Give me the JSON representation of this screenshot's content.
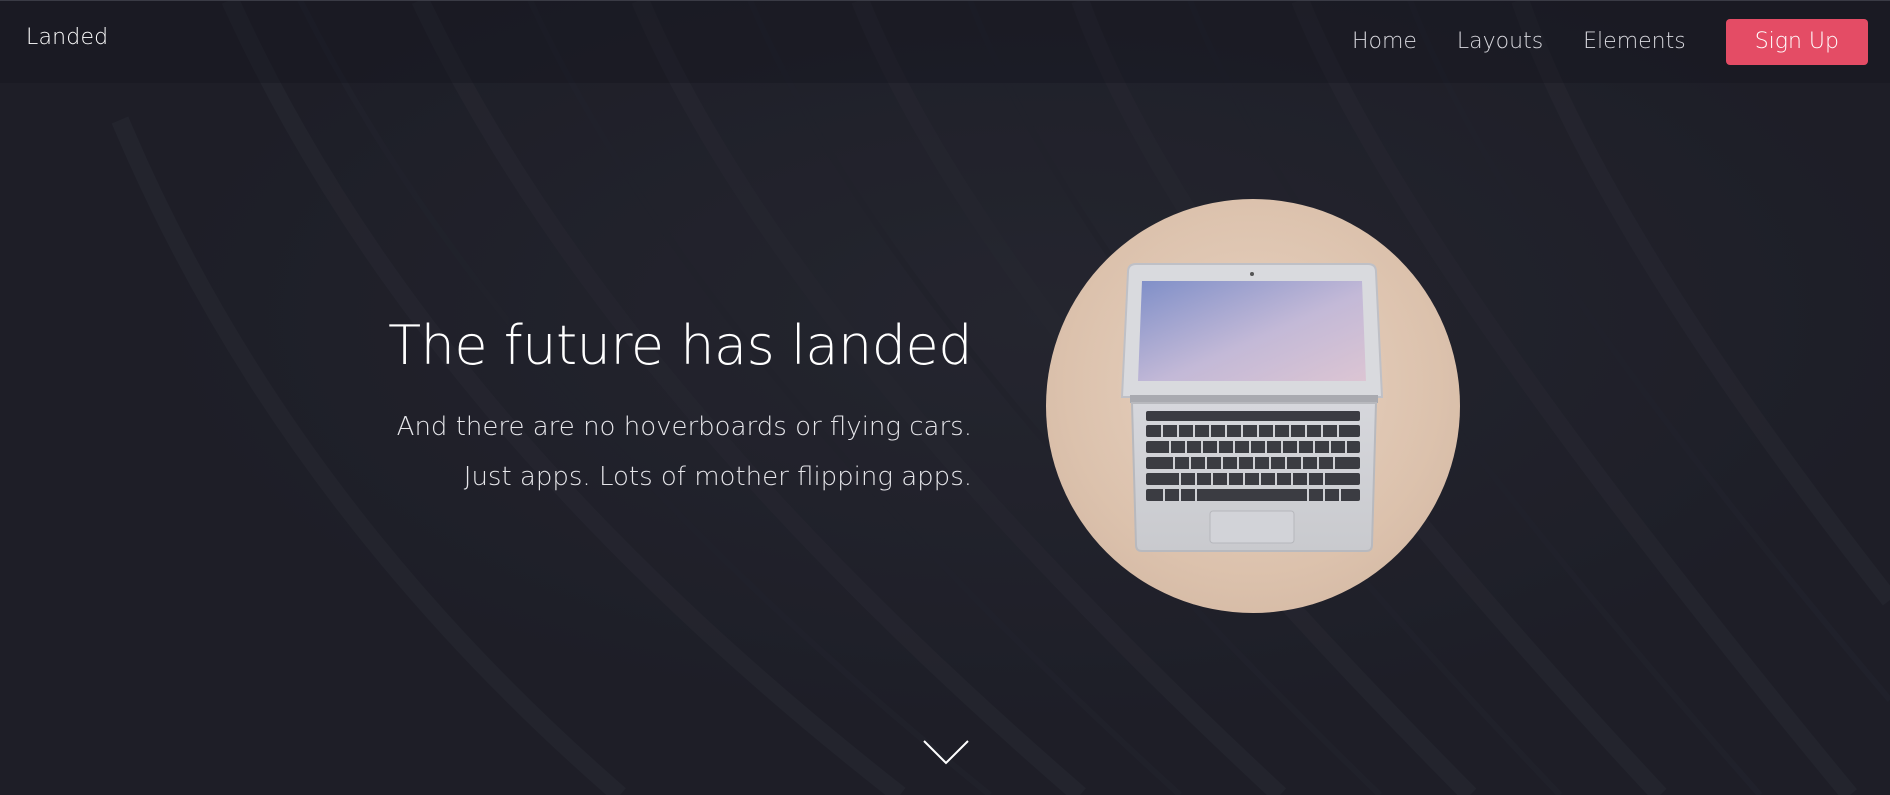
{
  "brand": {
    "name": "Landed"
  },
  "nav": {
    "items": [
      {
        "label": "Home"
      },
      {
        "label": "Layouts"
      },
      {
        "label": "Elements"
      }
    ],
    "signup_label": "Sign Up"
  },
  "hero": {
    "title": "The future has landed",
    "subtitle_line1": "And there are no hoverboards or flying cars.",
    "subtitle_line2": "Just apps. Lots of mother flipping apps.",
    "image_icon": "laptop-image",
    "scroll_icon": "chevron-down-icon"
  },
  "colors": {
    "accent": "#e44c65",
    "background": "#1f2029"
  }
}
